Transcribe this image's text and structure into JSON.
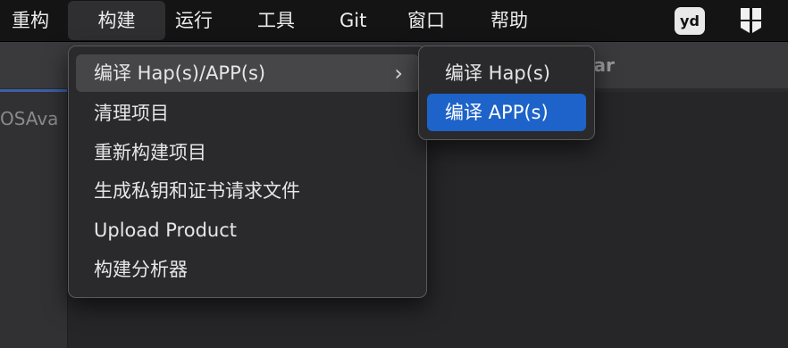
{
  "menubar": {
    "items": [
      "重构",
      "构建",
      "运行",
      "工具",
      "Git",
      "窗口",
      "帮助"
    ],
    "tray_yd_label": "yd"
  },
  "background": {
    "sidebar_text": "OSAva",
    "tab_text": "tar"
  },
  "build_menu": {
    "items": [
      "编译 Hap(s)/APP(s)",
      "清理项目",
      "重新构建项目",
      "生成私钥和证书请求文件",
      "Upload Product",
      "构建分析器"
    ],
    "submenu_chevron": "›"
  },
  "submenu": {
    "items": [
      "编译 Hap(s)",
      "编译 APP(s)"
    ],
    "selected": "编译 APP(s)"
  },
  "colors": {
    "menubar": "#141414",
    "menu_bg": "#2a2a2c",
    "hover": "#464648",
    "selected": "#1d63c9"
  }
}
